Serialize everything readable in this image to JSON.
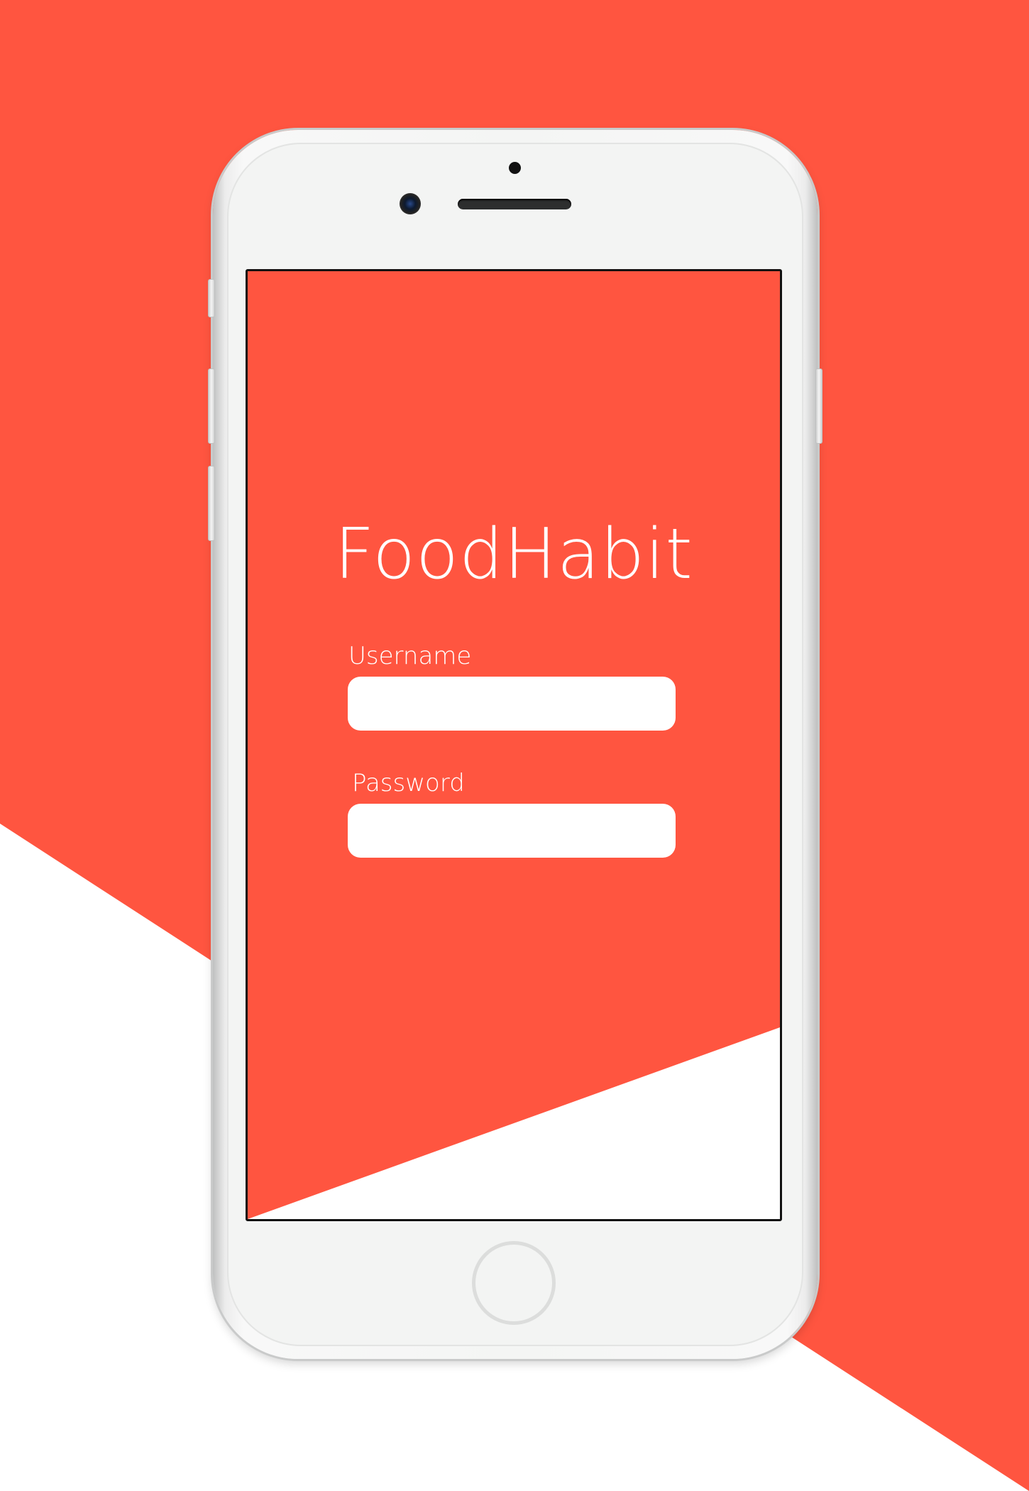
{
  "app": {
    "title": "FoodHabit"
  },
  "login": {
    "username_label": "Username",
    "username_value": "",
    "password_label": "Password",
    "password_value": ""
  },
  "colors": {
    "brand": "#ff5540",
    "background": "#ffffff",
    "field": "#ffffff",
    "device_body": "#f3f4f3"
  },
  "device": {
    "type": "iphone",
    "icons": [
      "front-camera-icon",
      "proximity-sensor-icon",
      "earpiece-speaker-icon",
      "home-button-icon"
    ]
  }
}
